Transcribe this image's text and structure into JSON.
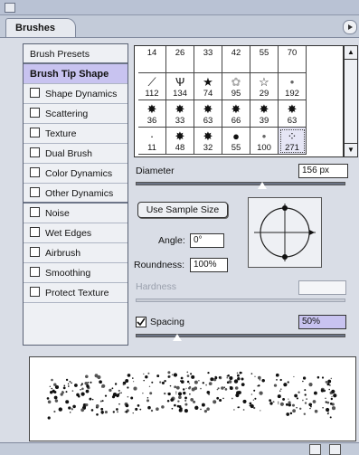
{
  "panel": {
    "tab_label": "Brushes"
  },
  "sidebar": {
    "items": [
      {
        "label": "Brush Presets",
        "checkbox": false,
        "selected": false
      },
      {
        "label": "Brush Tip Shape",
        "checkbox": false,
        "selected": true
      },
      {
        "label": "Shape Dynamics",
        "checkbox": true,
        "selected": false
      },
      {
        "label": "Scattering",
        "checkbox": true,
        "selected": false
      },
      {
        "label": "Texture",
        "checkbox": true,
        "selected": false
      },
      {
        "label": "Dual Brush",
        "checkbox": true,
        "selected": false
      },
      {
        "label": "Color Dynamics",
        "checkbox": true,
        "selected": false
      },
      {
        "label": "Other Dynamics",
        "checkbox": true,
        "selected": false
      },
      {
        "label": "Noise",
        "checkbox": true,
        "selected": false
      },
      {
        "label": "Wet Edges",
        "checkbox": true,
        "selected": false
      },
      {
        "label": "Airbrush",
        "checkbox": true,
        "selected": false
      },
      {
        "label": "Smoothing",
        "checkbox": true,
        "selected": false
      },
      {
        "label": "Protect Texture",
        "checkbox": true,
        "selected": false
      }
    ]
  },
  "brush_grid": {
    "cells": [
      {
        "num": "14",
        "icon": ""
      },
      {
        "num": "26",
        "icon": ""
      },
      {
        "num": "33",
        "icon": ""
      },
      {
        "num": "42",
        "icon": ""
      },
      {
        "num": "55",
        "icon": ""
      },
      {
        "num": "70",
        "icon": ""
      },
      {
        "num": "112",
        "icon": "stroke-icon"
      },
      {
        "num": "134",
        "icon": "grass-icon"
      },
      {
        "num": "74",
        "icon": "star-icon"
      },
      {
        "num": "95",
        "icon": "leaf-icon"
      },
      {
        "num": "29",
        "icon": "star-outline-icon"
      },
      {
        "num": "192",
        "icon": "soft-dot-icon"
      },
      {
        "num": "36",
        "icon": "scatter-icon"
      },
      {
        "num": "33",
        "icon": "scatter-icon"
      },
      {
        "num": "63",
        "icon": "scatter-icon"
      },
      {
        "num": "66",
        "icon": "scatter-icon"
      },
      {
        "num": "39",
        "icon": "scatter-icon"
      },
      {
        "num": "63",
        "icon": "scatter-icon"
      },
      {
        "num": "11",
        "icon": "speck-icon"
      },
      {
        "num": "48",
        "icon": "scatter-icon"
      },
      {
        "num": "32",
        "icon": "scatter-icon"
      },
      {
        "num": "55",
        "icon": "solid-dot-icon"
      },
      {
        "num": "100",
        "icon": "soft-dot-icon"
      },
      {
        "num": "271",
        "icon": "dotted-icon"
      }
    ],
    "selected_index": 23
  },
  "diameter": {
    "label": "Diameter",
    "value": "156 px",
    "slider_fraction": 0.61
  },
  "sample_button": {
    "label": "Use Sample Size"
  },
  "angle": {
    "label": "Angle:",
    "value": "0°"
  },
  "roundness": {
    "label": "Roundness:",
    "value": "100%"
  },
  "hardness": {
    "label": "Hardness",
    "value": ""
  },
  "spacing": {
    "label": "Spacing",
    "checked": true,
    "value": "50%",
    "slider_fraction": 0.2
  }
}
